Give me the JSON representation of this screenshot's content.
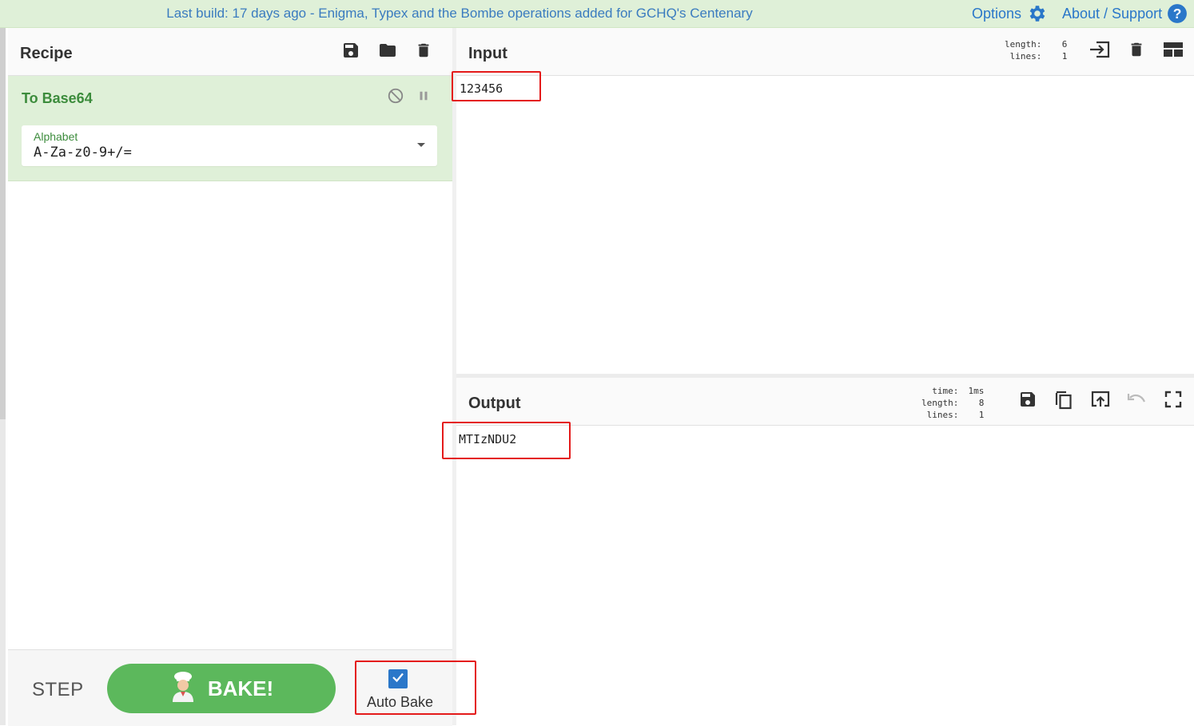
{
  "banner": {
    "message": "Last build: 17 days ago - Enigma, Typex and the Bombe operations added for GCHQ's Centenary",
    "options_label": "Options",
    "about_label": "About / Support"
  },
  "recipe": {
    "title": "Recipe",
    "operation": {
      "name": "To Base64",
      "argument_label": "Alphabet",
      "argument_value": "A-Za-z0-9+/="
    },
    "step_label": "STEP",
    "bake_label": "BAKE!",
    "autobake_label": "Auto Bake",
    "autobake_checked": true
  },
  "input": {
    "title": "Input",
    "text": "123456",
    "stats": {
      "length_label": "length:",
      "length": "6",
      "lines_label": "lines:",
      "lines": "1"
    }
  },
  "output": {
    "title": "Output",
    "text": "MTIzNDU2",
    "stats": {
      "time_label": "time:",
      "time": "1ms",
      "length_label": "length:",
      "length": "8",
      "lines_label": "lines:",
      "lines": "1"
    }
  },
  "colors": {
    "banner_bg": "#dff0d8",
    "operation_bg": "#dff0d8",
    "operation_text": "#3c8c3c",
    "bake_button": "#5cb85c",
    "link": "#2a77c9",
    "highlight": "#e41a1a"
  },
  "icons": [
    "gear-icon",
    "help-icon",
    "save-icon",
    "folder-icon",
    "trash-icon",
    "disable-icon",
    "pause-icon",
    "import-icon",
    "layout-icon",
    "copy-icon",
    "replace-input-icon",
    "undo-icon",
    "maximize-icon",
    "chef-icon",
    "checkmark-icon"
  ]
}
